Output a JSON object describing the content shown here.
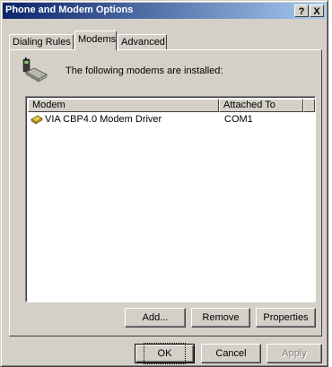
{
  "window": {
    "title": "Phone and Modem Options",
    "help_label": "?",
    "close_label": "X"
  },
  "tabs": [
    {
      "label": "Dialing Rules",
      "selected": false
    },
    {
      "label": "Modems",
      "selected": true
    },
    {
      "label": "Advanced",
      "selected": false
    }
  ],
  "panel": {
    "info_text": "The following modems are installed:",
    "icon": "phone-modem-icon"
  },
  "list": {
    "columns": [
      "Modem",
      "Attached To"
    ],
    "rows": [
      {
        "name": "VIA CBP4.0 Modem Driver",
        "port": "COM1",
        "icon": "modem-icon"
      }
    ]
  },
  "panel_buttons": {
    "add": "Add...",
    "remove": "Remove",
    "properties": "Properties"
  },
  "dialog_buttons": {
    "ok": "OK",
    "cancel": "Cancel",
    "apply": "Apply"
  },
  "colors": {
    "title_start": "#0a246a",
    "title_end": "#a6caf0",
    "face": "#d4d0c8"
  }
}
